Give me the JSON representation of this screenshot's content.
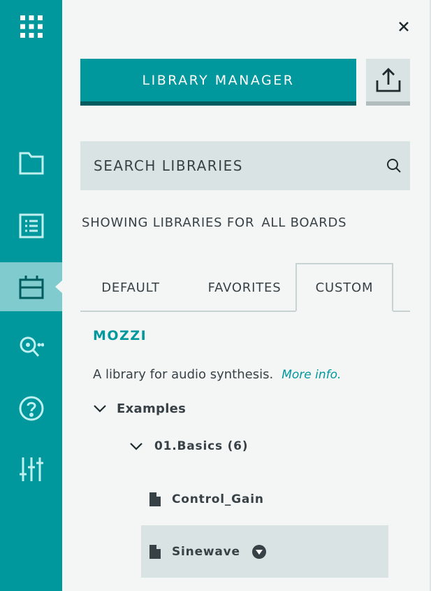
{
  "rail": {
    "items": [
      {
        "icon": "apps-grid-icon"
      },
      {
        "icon": "folder-icon"
      },
      {
        "icon": "list-icon"
      },
      {
        "icon": "library-icon",
        "active": true
      },
      {
        "icon": "monitor-search-icon"
      },
      {
        "icon": "help-icon"
      },
      {
        "icon": "preferences-sliders-icon"
      }
    ]
  },
  "panel": {
    "library_manager_label": "LIBRARY MANAGER",
    "search_placeholder": "SEARCH LIBRARIES",
    "showing_prefix": "SHOWING LIBRARIES FOR",
    "showing_boards": "ALL BOARDS",
    "tabs": [
      {
        "label": "DEFAULT",
        "active": false
      },
      {
        "label": "FAVORITES",
        "active": false
      },
      {
        "label": "CUSTOM",
        "active": true
      }
    ],
    "library": {
      "name": "MOZZI",
      "description": "A library for audio synthesis.",
      "more_info": "More info."
    },
    "tree": {
      "examples_label": "Examples",
      "folder_label": "01.Basics (6)",
      "files": [
        {
          "label": "Control_Gain",
          "selected": false
        },
        {
          "label": "Sinewave",
          "selected": true
        }
      ]
    }
  },
  "colors": {
    "teal": "#00979d",
    "teal_dark": "#005c5f",
    "rail_active": "#7fcbce",
    "text": "#374146",
    "field_bg": "#dae3e3"
  }
}
